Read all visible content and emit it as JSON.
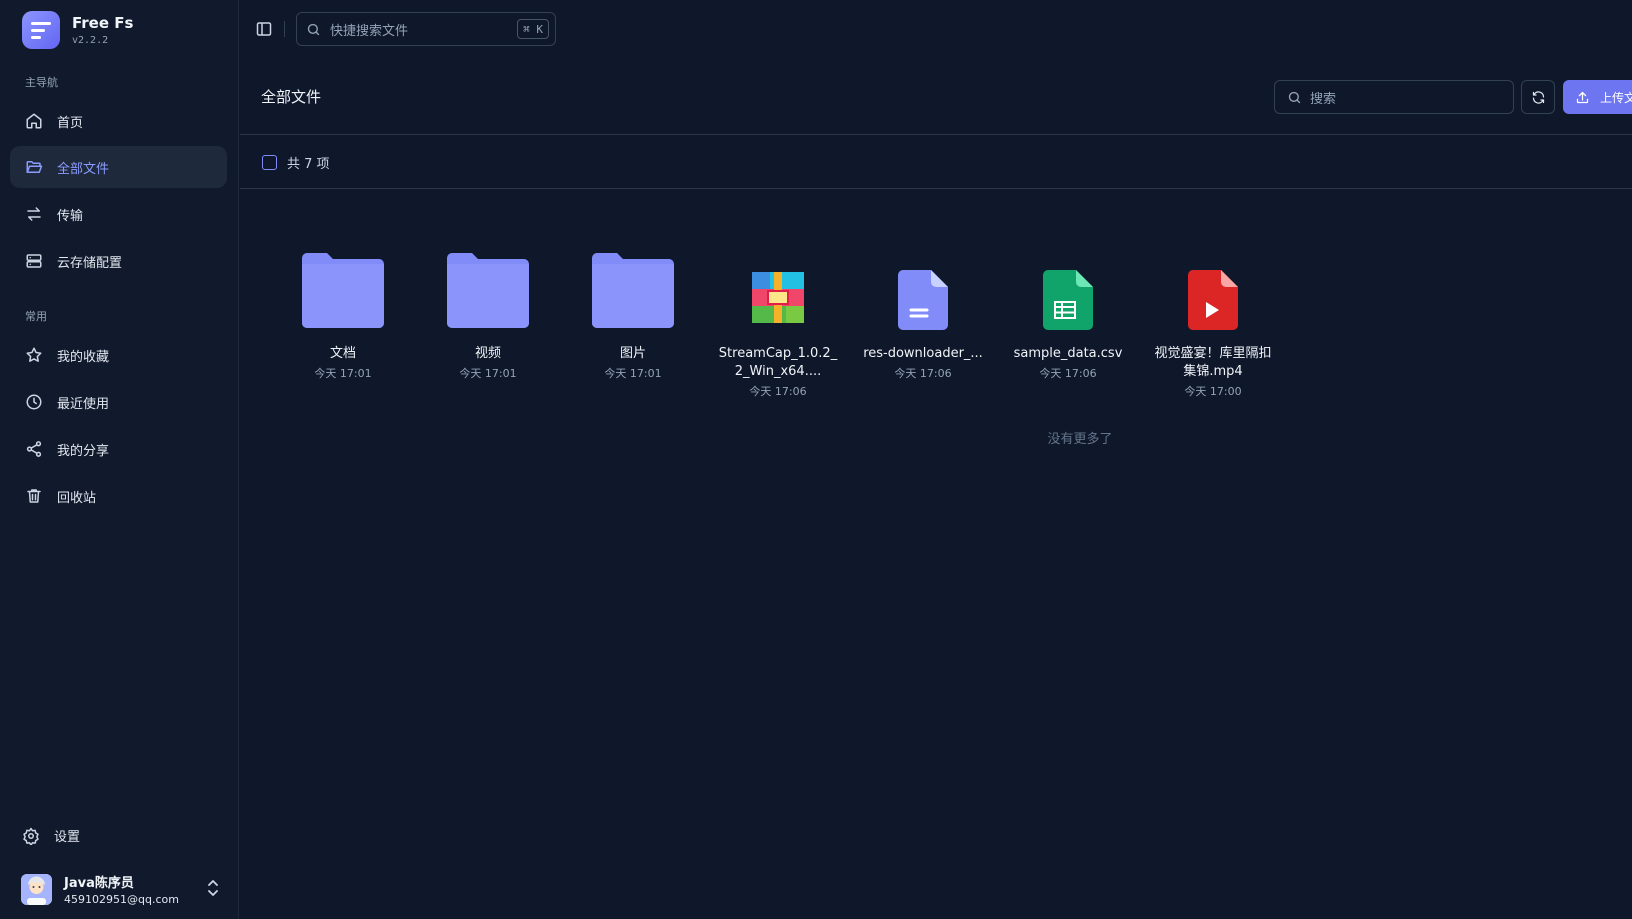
{
  "app": {
    "name": "Free Fs",
    "version": "v2.2.2"
  },
  "sidebar": {
    "main_label": "主导航",
    "main_items": [
      {
        "label": "首页",
        "icon": "home-icon"
      },
      {
        "label": "全部文件",
        "icon": "folder-open-icon",
        "active": true
      },
      {
        "label": "传输",
        "icon": "transfer-icon"
      },
      {
        "label": "云存储配置",
        "icon": "storage-icon"
      }
    ],
    "common_label": "常用",
    "common_items": [
      {
        "label": "我的收藏",
        "icon": "star-icon"
      },
      {
        "label": "最近使用",
        "icon": "clock-icon"
      },
      {
        "label": "我的分享",
        "icon": "share-icon"
      },
      {
        "label": "回收站",
        "icon": "trash-icon"
      }
    ],
    "settings_label": "设置",
    "user": {
      "name": "Java陈序员",
      "email": "459102951@qq.com"
    }
  },
  "topbar": {
    "quick_search_placeholder": "快捷搜索文件",
    "shortcut": "⌘ K"
  },
  "main": {
    "title": "全部文件",
    "search_placeholder": "搜索",
    "upload_label": "上传文件",
    "count_label": "共 7 项",
    "no_more": "没有更多了",
    "accent_color": "#6d75f0",
    "files": [
      {
        "name": "文档",
        "date": "今天 17:01",
        "type": "folder"
      },
      {
        "name": "视频",
        "date": "今天 17:01",
        "type": "folder"
      },
      {
        "name": "图片",
        "date": "今天 17:01",
        "type": "folder"
      },
      {
        "name": "StreamCap_1.0.2_2_Win_x64....",
        "date": "今天 17:06",
        "type": "archive"
      },
      {
        "name": "res-downloader_...",
        "date": "今天 17:06",
        "type": "document"
      },
      {
        "name": "sample_data.csv",
        "date": "今天 17:06",
        "type": "spreadsheet"
      },
      {
        "name": "视觉盛宴！库里隔扣集锦.mp4",
        "date": "今天 17:00",
        "type": "video"
      }
    ]
  }
}
